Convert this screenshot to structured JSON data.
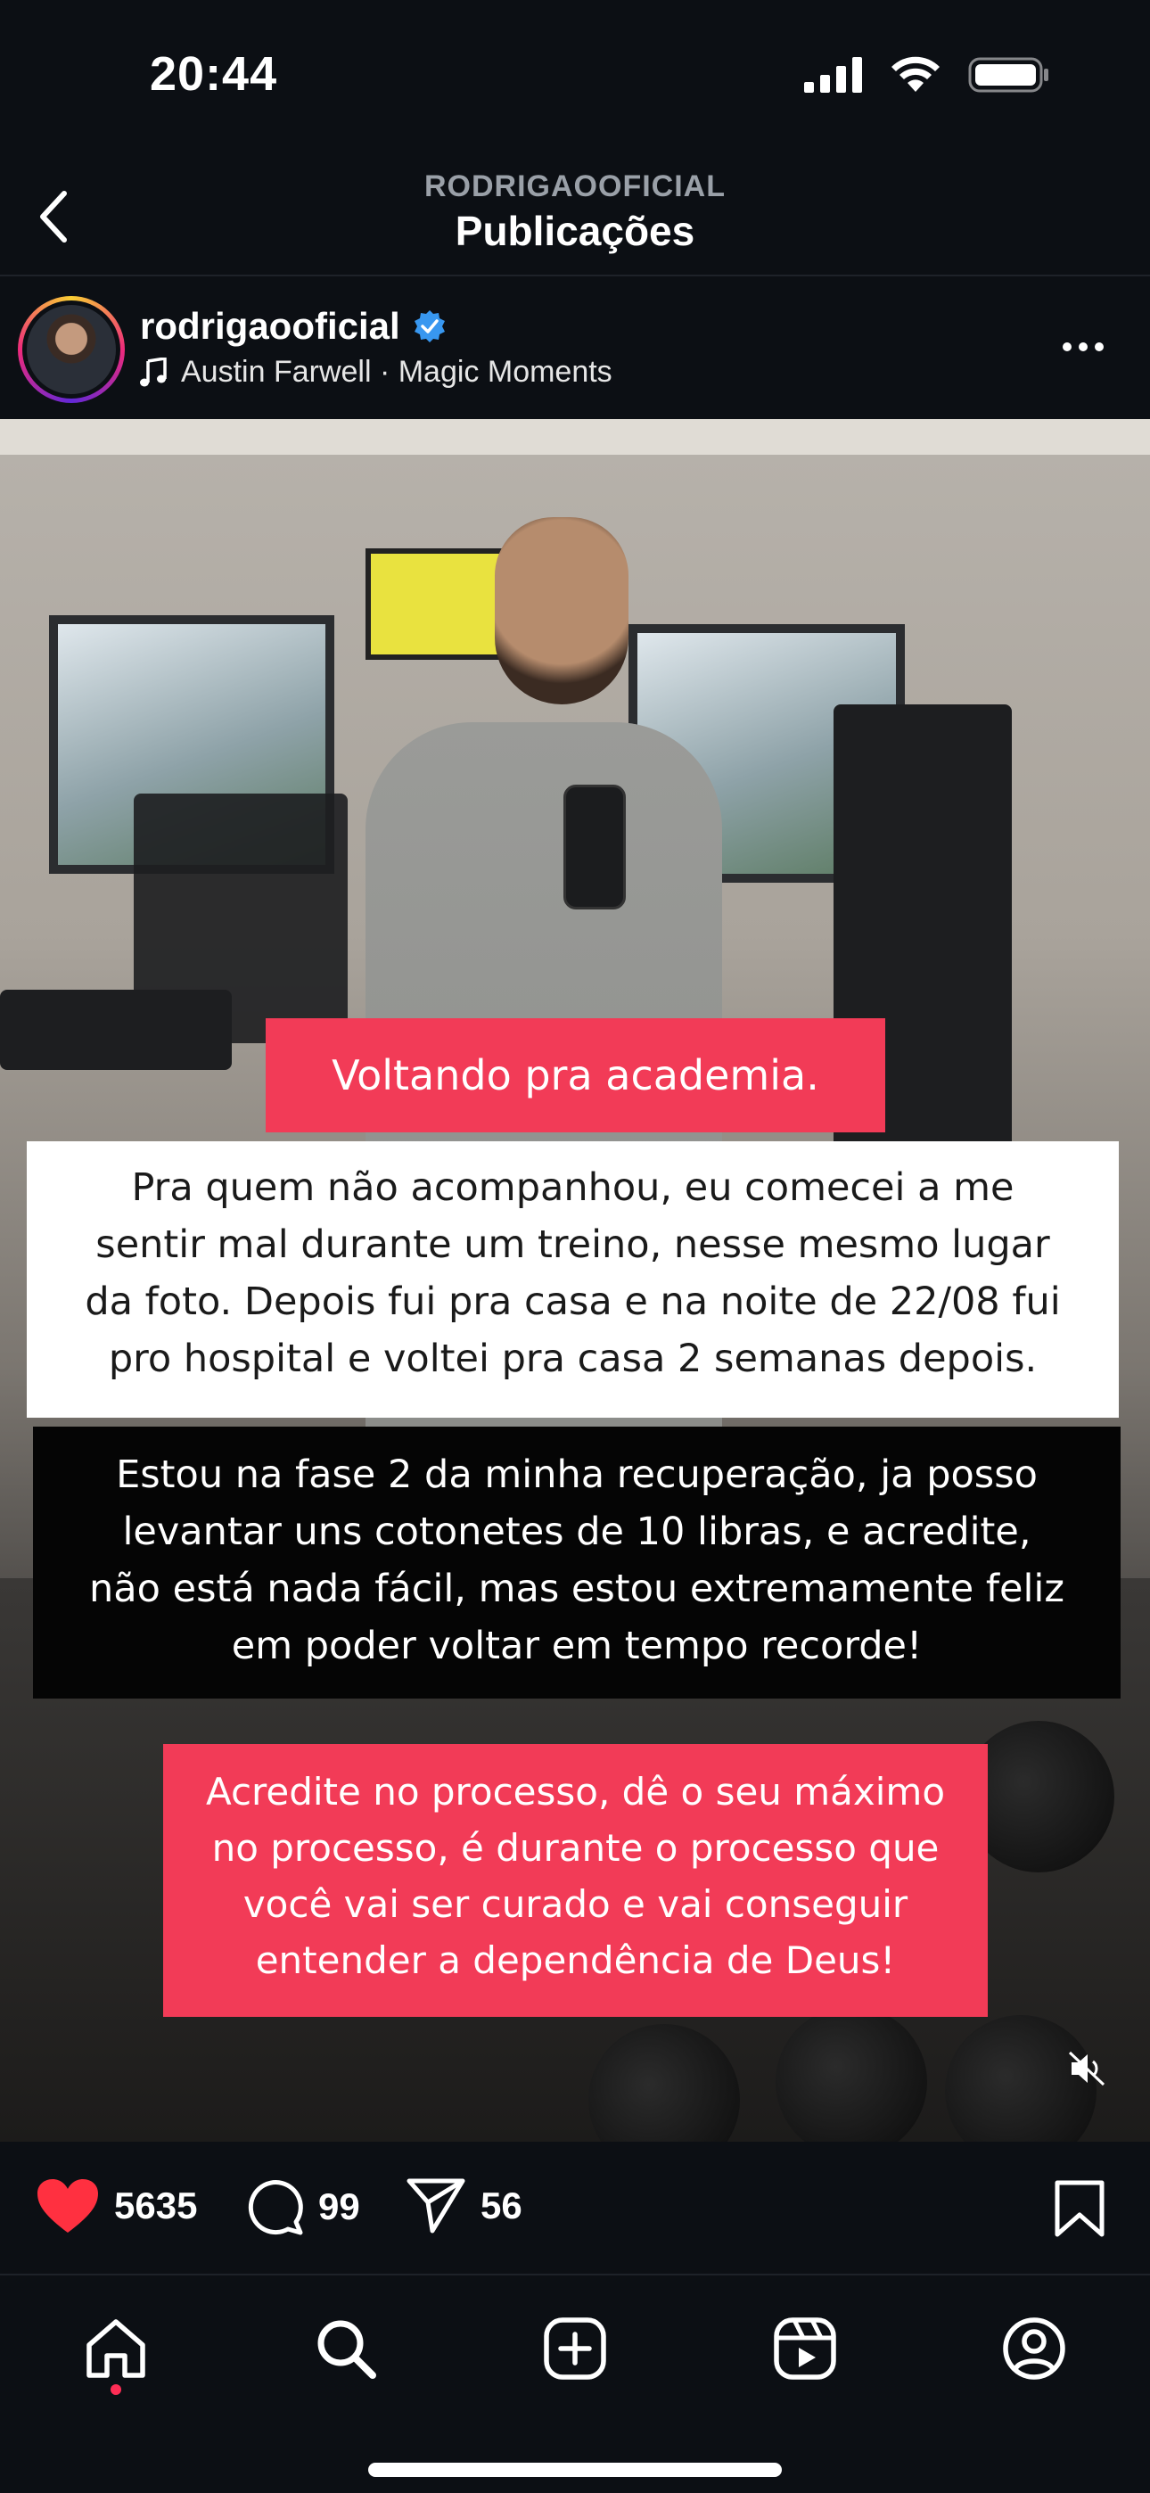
{
  "status_bar": {
    "time": "20:44"
  },
  "header": {
    "account": "RODRIGAOOFICIAL",
    "title": "Publicações"
  },
  "post": {
    "username": "rodrigaooficial",
    "verified": true,
    "music": "Austin Farwell · Magic Moments",
    "captions": {
      "line1": "Voltando pra academia.",
      "block2": [
        "Pra quem não acompanhou, eu comecei a me",
        "sentir mal durante um treino, nesse mesmo lugar",
        "da foto. Depois fui pra casa e na noite de 22/08 fui",
        "pro hospital e voltei pra casa 2 semanas depois."
      ],
      "block3": [
        "Estou na fase 2 da minha recuperação, ja posso",
        "levantar uns cotonetes de 10 libras, e acredite,",
        "não está nada fácil, mas estou extremamente feliz",
        "em poder voltar em tempo recorde!"
      ],
      "block4": [
        "Acredite no processo, dê o seu máximo",
        "no processo, é durante o processo que",
        "você vai ser curado e vai conseguir",
        "entender a dependência de Deus!"
      ]
    },
    "likes": "5635",
    "comments": "99",
    "shares": "56",
    "liked": true
  },
  "colors": {
    "accent_red": "#ff3040",
    "caption_red": "#f23b57",
    "verified_blue": "#3897f0"
  },
  "nav": [
    "home-icon",
    "search-icon",
    "create-icon",
    "reels-icon",
    "profile-icon"
  ]
}
